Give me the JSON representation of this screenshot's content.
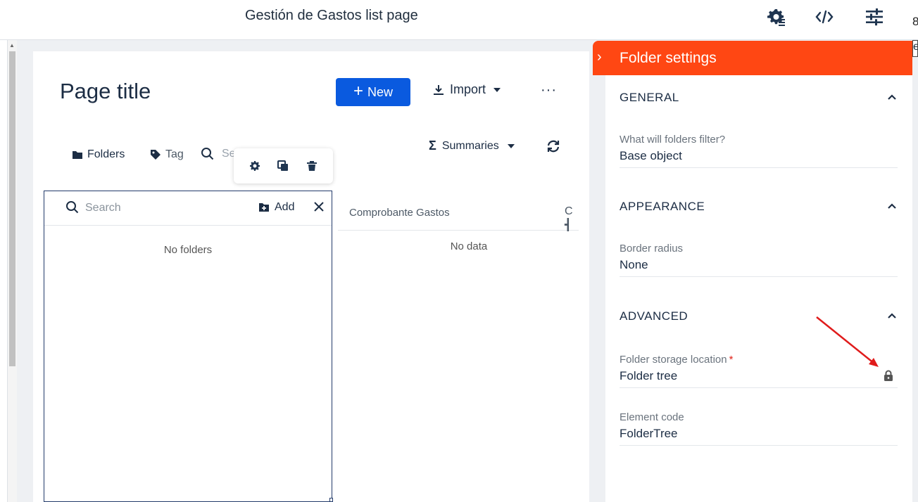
{
  "topbar": {
    "title": "Gestión de Gastos list page",
    "icons": [
      "gear-list-icon",
      "code-icon",
      "sliders-icon"
    ]
  },
  "clipped_text": {
    "a": "8",
    "b": "e"
  },
  "page": {
    "title": "Page title",
    "new_label": "New",
    "import_label": "Import",
    "more_label": "···",
    "folders_label": "Folders",
    "tag_label": "Tag",
    "search_label": "Search",
    "summaries_label": "Summaries"
  },
  "folder_tree": {
    "search_placeholder": "Search",
    "add_label": "Add",
    "empty_text": "No folders"
  },
  "table": {
    "columns": [
      "Comprobante Gastos",
      "C"
    ],
    "empty_text": "No data"
  },
  "settings_panel": {
    "title": "Folder settings",
    "sections": [
      {
        "title": "GENERAL",
        "fields": [
          {
            "label": "What will folders filter?",
            "value": "Base object"
          }
        ]
      },
      {
        "title": "APPEARANCE",
        "fields": [
          {
            "label": "Border radius",
            "value": "None"
          }
        ]
      },
      {
        "title": "ADVANCED",
        "fields": [
          {
            "label": "Folder storage location",
            "value": "Folder tree",
            "required_mark": "*"
          },
          {
            "label": "Element code",
            "value": "FolderTree"
          }
        ]
      }
    ]
  },
  "colors": {
    "accent": "#ff4713",
    "primary": "#0a5adf",
    "annotation": "#e01b1b"
  }
}
